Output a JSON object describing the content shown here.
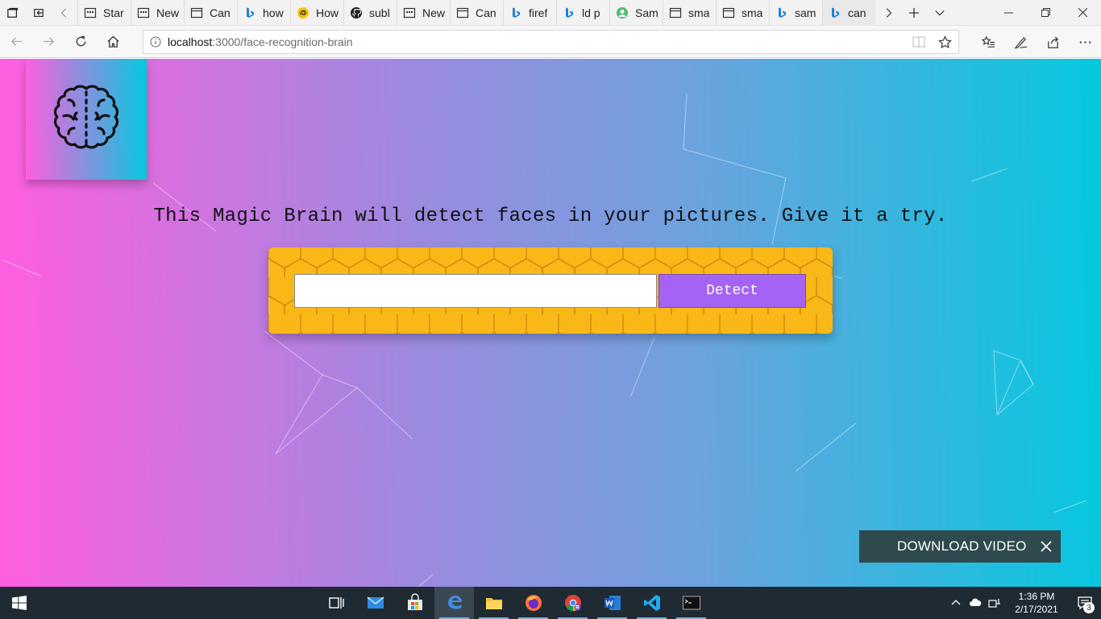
{
  "browser": {
    "tabs": [
      {
        "label": "Star",
        "icon": "page-grid-icon"
      },
      {
        "label": "New",
        "icon": "page-grid-icon"
      },
      {
        "label": "Can",
        "icon": "page-icon"
      },
      {
        "label": "how",
        "icon": "bing-icon"
      },
      {
        "label": "How",
        "icon": "site-icon"
      },
      {
        "label": "subl",
        "icon": "github-icon"
      },
      {
        "label": "New",
        "icon": "page-grid-icon"
      },
      {
        "label": "Can",
        "icon": "page-icon"
      },
      {
        "label": "firef",
        "icon": "bing-icon"
      },
      {
        "label": "ld p",
        "icon": "bing-icon"
      },
      {
        "label": "Sam",
        "icon": "profile-icon"
      },
      {
        "label": "sma",
        "icon": "page-icon"
      },
      {
        "label": "sma",
        "icon": "page-icon"
      },
      {
        "label": "sam",
        "icon": "bing-icon"
      },
      {
        "label": "can",
        "icon": "bing-icon"
      }
    ],
    "address": {
      "host": "localhost",
      "path": ":3000/face-recognition-brain"
    }
  },
  "page": {
    "tagline": "This Magic Brain will detect faces in your pictures. Give it a try.",
    "input_placeholder": "",
    "detect_label": "Detect",
    "download_video_label": "DOWNLOAD VIDEO"
  },
  "taskbar": {
    "apps": [
      {
        "name": "task-view",
        "running": false
      },
      {
        "name": "mail",
        "running": false
      },
      {
        "name": "store",
        "running": false
      },
      {
        "name": "edge",
        "running": true,
        "active": true
      },
      {
        "name": "file-explorer",
        "running": true
      },
      {
        "name": "firefox",
        "running": true
      },
      {
        "name": "chrome",
        "running": true
      },
      {
        "name": "word",
        "running": true
      },
      {
        "name": "vscode",
        "running": true
      },
      {
        "name": "terminal",
        "running": true
      }
    ],
    "time": "1:36 PM",
    "date": "2/17/2021",
    "notification_count": "3"
  },
  "colors": {
    "gradient_left": "#ff5edf",
    "gradient_right": "#04c8de",
    "detect_button": "#a463f2",
    "honeycomb": "#f9b817",
    "download_bar": "#2f4a4f"
  }
}
